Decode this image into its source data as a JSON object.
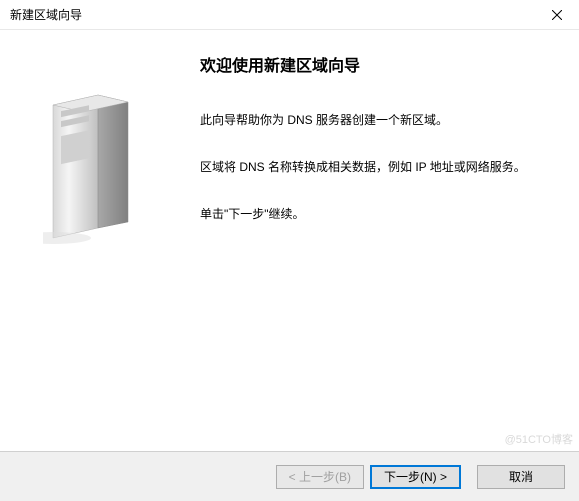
{
  "titlebar": {
    "title": "新建区域向导"
  },
  "content": {
    "welcome_title": "欢迎使用新建区域向导",
    "paragraph1": "此向导帮助你为 DNS 服务器创建一个新区域。",
    "paragraph2": "区域将 DNS 名称转换成相关数据，例如 IP 地址或网络服务。",
    "paragraph3": "单击\"下一步\"继续。"
  },
  "buttons": {
    "back": "< 上一步(B)",
    "next": "下一步(N) >",
    "cancel": "取消"
  },
  "watermark": "@51CTO博客"
}
